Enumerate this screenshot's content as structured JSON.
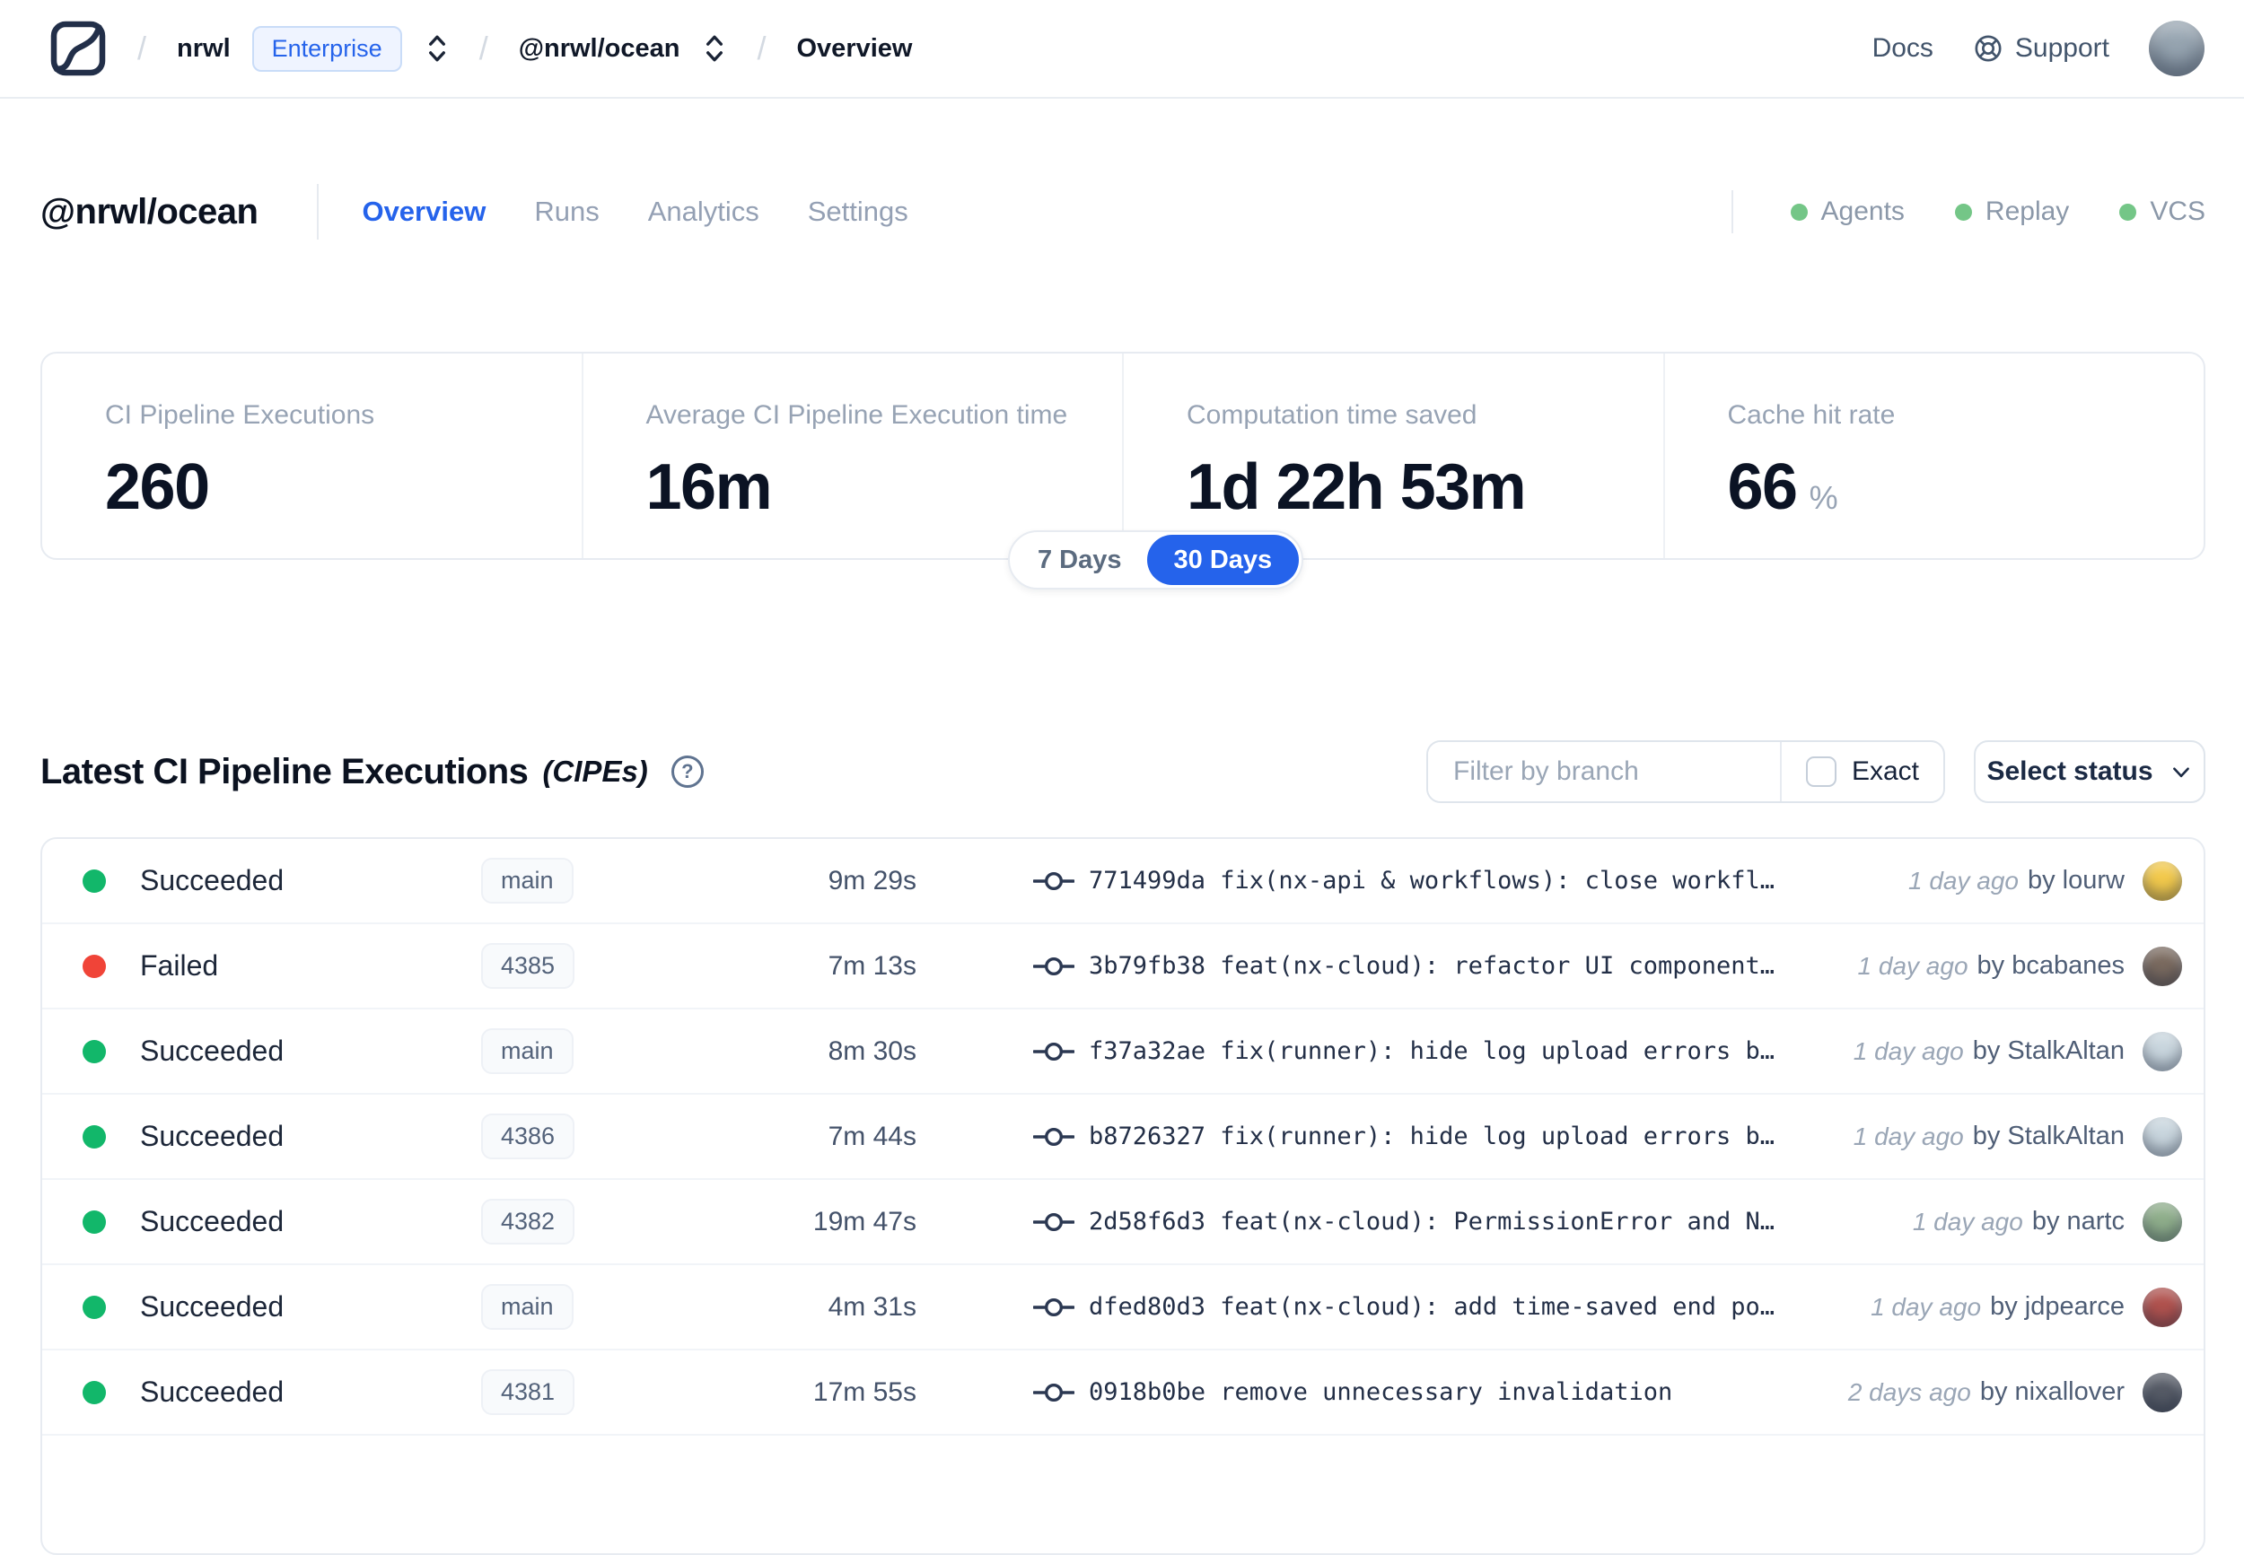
{
  "nav": {
    "separator": "/",
    "org": "nrwl",
    "org_badge": "Enterprise",
    "workspace": "@nrwl/ocean",
    "page": "Overview",
    "docs": "Docs",
    "support": "Support",
    "avatar_color": "#97a5b1"
  },
  "header": {
    "title": "@nrwl/ocean",
    "tabs": [
      {
        "label": "Overview",
        "active": true
      },
      {
        "label": "Runs",
        "active": false
      },
      {
        "label": "Analytics",
        "active": false
      },
      {
        "label": "Settings",
        "active": false
      }
    ],
    "indicators": [
      {
        "label": "Agents",
        "color": "#74c687"
      },
      {
        "label": "Replay",
        "color": "#74c687"
      },
      {
        "label": "VCS",
        "color": "#74c687"
      }
    ]
  },
  "stats": {
    "cards": [
      {
        "label": "CI Pipeline Executions",
        "value": "260",
        "suffix": ""
      },
      {
        "label": "Average CI Pipeline Execution time",
        "value": "16m",
        "suffix": ""
      },
      {
        "label": "Computation time saved",
        "value": "1d 22h 53m",
        "suffix": ""
      },
      {
        "label": "Cache hit rate",
        "value": "66",
        "suffix": "%"
      }
    ],
    "range_toggle": {
      "options": [
        {
          "label": "7 Days",
          "active": false
        },
        {
          "label": "30 Days",
          "active": true
        }
      ]
    }
  },
  "section": {
    "title": "Latest CI Pipeline Executions",
    "suffix": "(CIPEs)",
    "help_glyph": "?",
    "filter_placeholder": "Filter by branch",
    "exact_label": "Exact",
    "exact_checked": false,
    "status_select_label": "Select status"
  },
  "table": {
    "rows": [
      {
        "status": "Succeeded",
        "status_color": "#12b76a",
        "branch": "main",
        "duration": "9m 29s",
        "commit_hash": "771499da",
        "commit_message": "fix(nx-api & workflows): close workfl…",
        "time_ago": "1 day ago",
        "author": "by lourw",
        "avatar_color": "#f2c94c"
      },
      {
        "status": "Failed",
        "status_color": "#f04438",
        "branch": "4385",
        "duration": "7m 13s",
        "commit_hash": "3b79fb38",
        "commit_message": "feat(nx-cloud): refactor UI component…",
        "time_ago": "1 day ago",
        "author": "by bcabanes",
        "avatar_color": "#7a6a5f"
      },
      {
        "status": "Succeeded",
        "status_color": "#12b76a",
        "branch": "main",
        "duration": "8m 30s",
        "commit_hash": "f37a32ae",
        "commit_message": "fix(runner): hide log upload errors b…",
        "time_ago": "1 day ago",
        "author": "by StalkAltan",
        "avatar_color": "#c9d6de"
      },
      {
        "status": "Succeeded",
        "status_color": "#12b76a",
        "branch": "4386",
        "duration": "7m 44s",
        "commit_hash": "b8726327",
        "commit_message": "fix(runner): hide log upload errors b…",
        "time_ago": "1 day ago",
        "author": "by StalkAltan",
        "avatar_color": "#c9d6de"
      },
      {
        "status": "Succeeded",
        "status_color": "#12b76a",
        "branch": "4382",
        "duration": "19m 47s",
        "commit_hash": "2d58f6d3",
        "commit_message": "feat(nx-cloud): PermissionError and N…",
        "time_ago": "1 day ago",
        "author": "by nartc",
        "avatar_color": "#8fae8b"
      },
      {
        "status": "Succeeded",
        "status_color": "#12b76a",
        "branch": "main",
        "duration": "4m 31s",
        "commit_hash": "dfed80d3",
        "commit_message": "feat(nx-cloud): add time-saved end po…",
        "time_ago": "1 day ago",
        "author": "by jdpearce",
        "avatar_color": "#b0524e"
      },
      {
        "status": "Succeeded",
        "status_color": "#12b76a",
        "branch": "4381",
        "duration": "17m 55s",
        "commit_hash": "0918b0be",
        "commit_message": "remove unnecessary invalidation",
        "time_ago": "2 days ago",
        "author": "by nixallover",
        "avatar_color": "#565b66"
      }
    ]
  },
  "colors": {
    "accent_blue": "#2563eb",
    "success_green": "#12b76a",
    "fail_red": "#f04438",
    "indicator_green": "#74c687"
  }
}
